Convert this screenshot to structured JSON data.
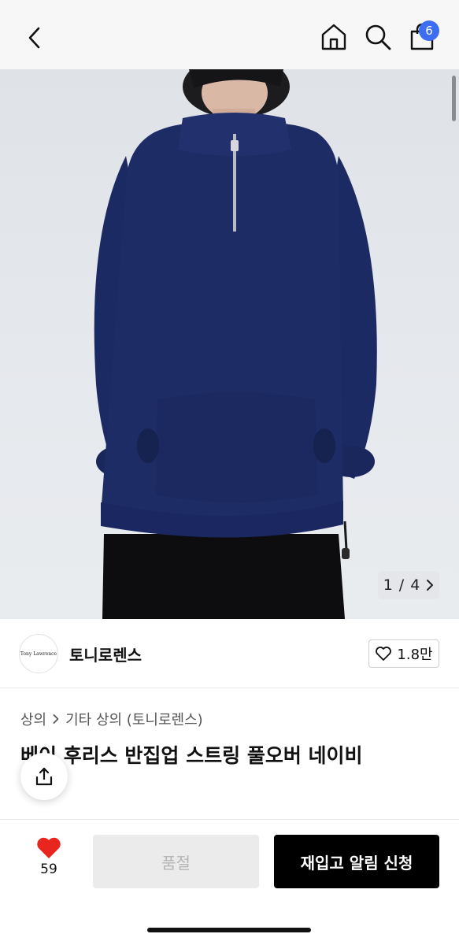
{
  "header": {
    "back_icon": "chevron-left-icon",
    "home_icon": "home-icon",
    "search_icon": "search-icon",
    "bag_icon": "shopping-bag-icon",
    "cart_count": "6",
    "badge_color": "#3d6df0"
  },
  "gallery": {
    "pager_current": "1",
    "pager_sep": "/",
    "pager_total": "4",
    "pager_icon": "chevron-right-icon"
  },
  "seller": {
    "logo_text": "Tony Lawrence",
    "name": "토니로렌스",
    "likes": "1.8만",
    "like_icon": "heart-outline-icon"
  },
  "breadcrumb": {
    "category": "상의",
    "separator_icon": "chevron-right-icon",
    "subcategory": "기타 상의 (토니로렌스)"
  },
  "product": {
    "title": "베이 후리스 반집업 스트링 풀오버 네이비"
  },
  "share": {
    "icon": "share-icon"
  },
  "bottom_bar": {
    "wish_icon": "heart-filled-icon",
    "wish_count": "59",
    "wish_color": "#e8251f",
    "soldout_label": "품절",
    "restock_label": "재입고 알림 신청"
  }
}
